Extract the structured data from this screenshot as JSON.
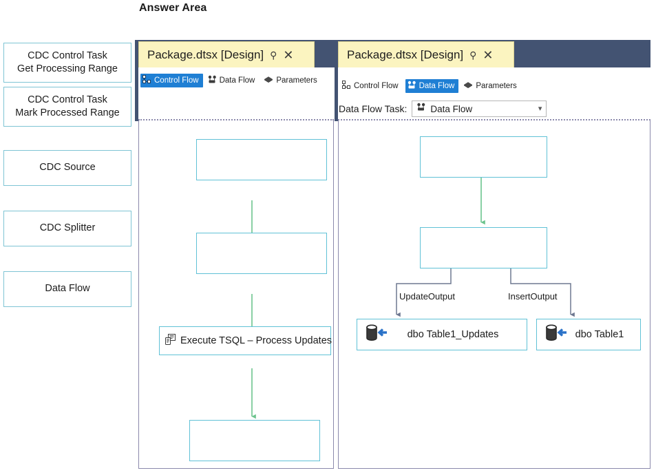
{
  "heading": "Answer Area",
  "colors": {
    "tab_yellow": "#fbf4c0",
    "title_dark": "#435372",
    "selected_tab_blue": "#1f7fd4",
    "box_border_cyan": "#5fc1d6",
    "green_connector": "#6cc48e",
    "gray_connector": "#6e7891"
  },
  "palette": {
    "items": [
      {
        "label": "CDC Control Task\nGet Processing Range"
      },
      {
        "label": "CDC Control Task\nMark Processed Range"
      },
      {
        "label": "CDC Source"
      },
      {
        "label": "CDC Splitter"
      },
      {
        "label": "Data Flow"
      }
    ]
  },
  "left_designer": {
    "tab": {
      "title": "Package.dtsx [Design]",
      "pin_icon": "pin-icon",
      "close_icon": "close-icon"
    },
    "view_tabs": [
      {
        "label": "Control Flow",
        "icon": "control-flow-icon",
        "selected": true
      },
      {
        "label": "Data Flow",
        "icon": "data-flow-icon",
        "selected": false
      },
      {
        "label": "Parameters",
        "icon": "parameters-icon",
        "selected": false
      }
    ],
    "boxes": [
      {
        "label": "",
        "icon": ""
      },
      {
        "label": "",
        "icon": ""
      },
      {
        "label": "Execute TSQL – Process Updates",
        "icon": "execute-sql-task-icon"
      },
      {
        "label": "",
        "icon": ""
      }
    ]
  },
  "right_designer": {
    "tab": {
      "title": "Package.dtsx [Design]",
      "pin_icon": "pin-icon",
      "close_icon": "close-icon"
    },
    "view_tabs": [
      {
        "label": "Control Flow",
        "icon": "control-flow-icon",
        "selected": false
      },
      {
        "label": "Data Flow",
        "icon": "data-flow-icon",
        "selected": true
      },
      {
        "label": "Parameters",
        "icon": "parameters-icon",
        "selected": false
      }
    ],
    "data_flow_task": {
      "label": "Data Flow Task:",
      "selected_value": "Data Flow",
      "icon": "data-flow-icon",
      "chevron": "chevron-down-icon"
    },
    "boxes": [
      {
        "label": ""
      },
      {
        "label": ""
      }
    ],
    "edge_labels": [
      {
        "label": "UpdateOutput"
      },
      {
        "label": "InsertOutput"
      }
    ],
    "destinations": [
      {
        "label": "dbo Table1_Updates",
        "icon": "ole-db-destination-icon"
      },
      {
        "label": "dbo Table1",
        "icon": "ole-db-destination-icon"
      }
    ]
  }
}
